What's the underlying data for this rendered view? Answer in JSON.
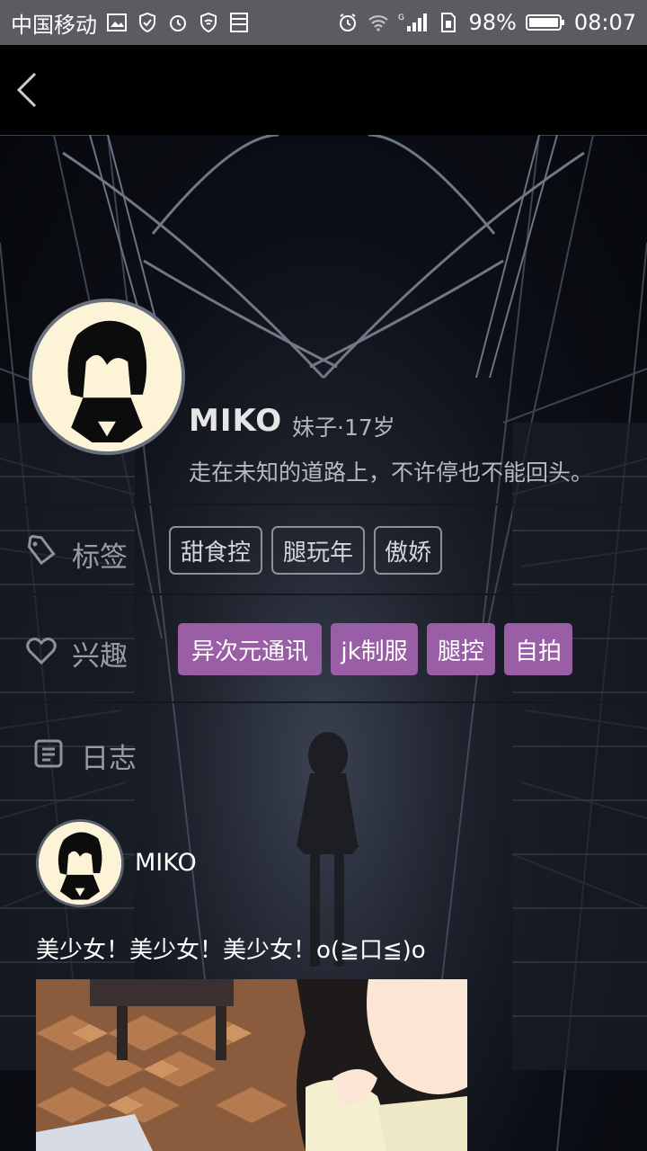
{
  "status_bar": {
    "carrier": "中国移动",
    "battery": "98%",
    "time": "08:07",
    "network": "G"
  },
  "nav": {
    "back_icon": "chevron-left-icon"
  },
  "profile": {
    "name": "MIKO",
    "meta": "妹子·17岁",
    "signature": "走在未知的道路上，不许停也不能回头。"
  },
  "tags_row": {
    "label": "标签",
    "icon": "tag-icon",
    "items": [
      "甜食控",
      "腿玩年",
      "傲娇"
    ]
  },
  "interests_row": {
    "label": "兴趣",
    "icon": "heart-icon",
    "items": [
      "异次元通讯",
      "jk制服",
      "腿控",
      "自拍"
    ],
    "color": "#9a5ea6"
  },
  "diary": {
    "label": "日志",
    "icon": "document-icon"
  },
  "post": {
    "author": "MIKO",
    "text": "美少女！美少女！美少女！o(≧口≦)o"
  }
}
